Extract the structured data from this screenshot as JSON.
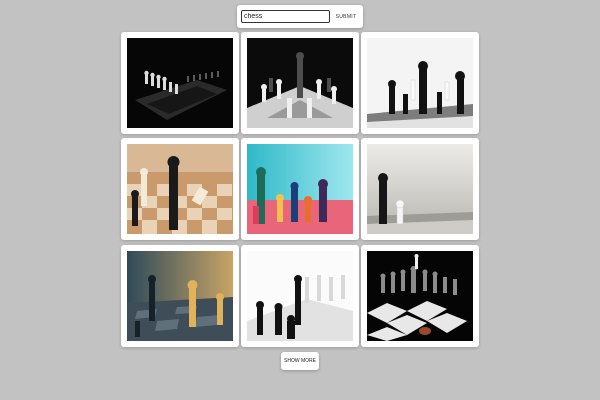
{
  "search": {
    "value": "chess",
    "submit_label": "SUBMIT"
  },
  "gallery": {
    "images": [
      {
        "alt": "chess pieces on dark board in black background"
      },
      {
        "alt": "black and white chess pieces mid-game"
      },
      {
        "alt": "black and white kings and pawns on board"
      },
      {
        "alt": "wooden chess pieces on wooden board"
      },
      {
        "alt": "colorful chess pieces on pink surface with teal background"
      },
      {
        "alt": "black king and white pawn on grey background"
      },
      {
        "alt": "black and golden pieces on board with blurred background"
      },
      {
        "alt": "black and white pieces on white board"
      },
      {
        "alt": "silver chess set on checkered board with black background"
      }
    ]
  },
  "pagination": {
    "show_more_label": "SHOW MORE"
  }
}
